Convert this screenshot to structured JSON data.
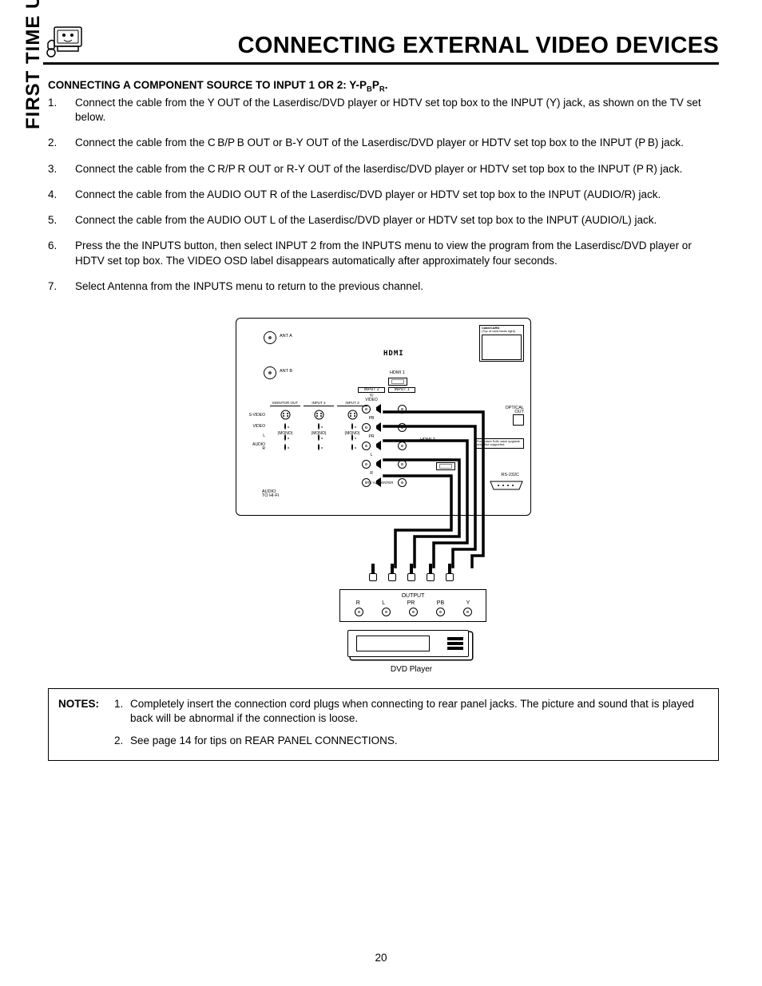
{
  "header": {
    "title": "CONNECTING EXTERNAL VIDEO DEVICES"
  },
  "sidebar": {
    "tab_label": "FIRST TIME USE"
  },
  "section": {
    "heading_pre": "CONNECTING A COMPONENT SOURCE TO INPUT 1 OR 2:  Y-P",
    "heading_sub1": "B",
    "heading_mid": "P",
    "heading_sub2": "R",
    "heading_post": "."
  },
  "steps": [
    "Connect the cable from the Y OUT of the Laserdisc/DVD player or HDTV set top box to the INPUT (Y) jack, as shown on the TV set below.",
    "Connect the cable from the C B/P B OUT or B-Y OUT of the Laserdisc/DVD  player or HDTV set top box to the INPUT (P B) jack.",
    "Connect the cable from the C R/P R OUT or R-Y OUT of the laserdisc/DVD player or HDTV set top box to the INPUT (P R) jack.",
    "Connect the cable from the AUDIO OUT R of the Laserdisc/DVD player or  HDTV set top box to the INPUT (AUDIO/R) jack.",
    "Connect the cable from the AUDIO OUT L of the Laserdisc/DVD player or HDTV set top box to the INPUT (AUDIO/L) jack.",
    "Press the the INPUTS button, then select INPUT 2 from the INPUTS menu to view the program from the Laserdisc/DVD player or HDTV set top box.  The VIDEO OSD label disappears automatically after approximately four seconds.",
    "Select Antenna from the INPUTS menu to return to the previous channel."
  ],
  "notes": {
    "label": "NOTES:",
    "items": [
      "Completely insert the connection cord plugs when connecting to rear panel jacks.  The picture and sound that is played back will be abnormal if the connection is loose.",
      "See page 14 for tips on REAR PANEL CONNECTIONS."
    ]
  },
  "diagram": {
    "ant_a": "ANT A",
    "ant_b": "ANT B",
    "cablecard": "CableCARD",
    "cablecard_sub": "(Top of card faces right)",
    "hdmi_logo": "HDMI",
    "hdmi1": "HDMI 1",
    "hdmi2": "HDMI 2",
    "monitor_out": "MONITOR OUT",
    "input4": "INPUT 4",
    "input3": "INPUT 3",
    "input2": "INPUT 2",
    "input1": "INPUT 1",
    "svideo": "S-VIDEO",
    "video": "VIDEO",
    "y_video": "Y/\nVIDEO",
    "pb": "PB",
    "pr": "PR",
    "audio": "AUDIO",
    "mono": "(MONO)",
    "l": "L",
    "r": "R",
    "audio_hifi": "AUDIO\nTO HI-FI",
    "tv_as_center": "TV AS CENTER",
    "optical": "OPTICAL\nOUT",
    "rs232c": "RS-232C",
    "upgrade_note": "For Future Soft-\nware upgrade only.\nNot supported.",
    "output_title": "OUTPUT",
    "output_labels": [
      "R",
      "L",
      "PR",
      "PB",
      "Y"
    ],
    "dvd_caption": "DVD Player"
  },
  "page_number": "20"
}
